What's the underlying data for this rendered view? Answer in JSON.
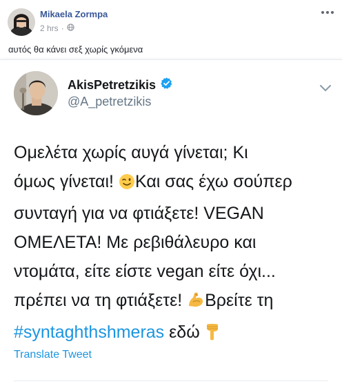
{
  "post": {
    "author": "Mikaela Zormpa",
    "time": "2 hrs",
    "separator": "·",
    "privacy_icon": "globe-icon",
    "more_icon": "ellipsis-icon",
    "caption": "αυτός θα κάνει σεξ χωρίς γκόμενα"
  },
  "tweet": {
    "display_name": "AkisPetretzikis",
    "verified_icon": "verified-badge-icon",
    "handle": "@A_petretzikis",
    "caret_icon": "chevron-down-icon",
    "lines": {
      "l1": "Ομελέτα χωρίς αυγά γίνεται; Κι",
      "l2a": "όμως γίνεται! ",
      "l2_emoji": "winking-face-emoji",
      "l2b": "Και σας έχω σούπερ",
      "l3": "συνταγή για να φτιάξετε! VEGAN",
      "l4": "ΟΜΕΛΕΤΑ! Με ρεβιθάλευρο και",
      "l5": "ντομάτα, είτε είστε vegan είτε όχι...",
      "l6a": "πρέπει να τη φτιάξετε! ",
      "l6_emoji": "flexed-biceps-emoji",
      "l6b": "Βρείτε τη",
      "l7_hashtag": "#syntaghthshmeras",
      "l7b": " εδώ ",
      "l7_emoji": "backhand-index-pointing-down-emoji"
    },
    "translate_label": "Translate Tweet"
  },
  "colors": {
    "fb_link": "#385898",
    "fb_meta": "#90949c",
    "tweet_text": "#14171a",
    "tweet_secondary": "#657786",
    "twitter_blue": "#1b95e0",
    "verified_blue": "#1da1f2"
  }
}
